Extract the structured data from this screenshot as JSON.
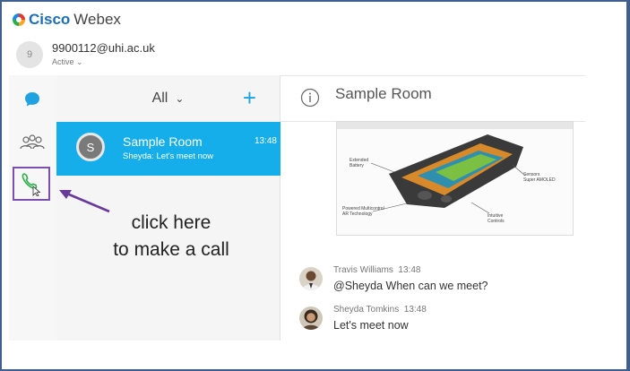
{
  "brand": {
    "cisco": "Cisco",
    "webex": "Webex"
  },
  "user": {
    "avatar_initial": "9",
    "email": "9900112@uhi.ac.uk",
    "status": "Active"
  },
  "rail": {
    "icons": [
      "chat-icon",
      "people-icon",
      "phone-icon"
    ]
  },
  "list": {
    "filter_label": "All",
    "rooms": [
      {
        "initial": "S",
        "title": "Sample Room",
        "snippet": "Sheyda: Let's meet now",
        "time": "13:48"
      }
    ]
  },
  "room": {
    "title": "Sample Room"
  },
  "messages": [
    {
      "author": "Travis Williams",
      "time": "13:48",
      "text": "@Sheyda When can we meet?"
    },
    {
      "author": "Sheyda Tomkins",
      "time": "13:48",
      "text": "Let's meet now"
    }
  ],
  "annotation": {
    "line1": "click here",
    "line2": "to make a call"
  },
  "colors": {
    "accent": "#16aeea",
    "highlight": "#7a4fb0",
    "brand_blue": "#1e6fb5"
  }
}
